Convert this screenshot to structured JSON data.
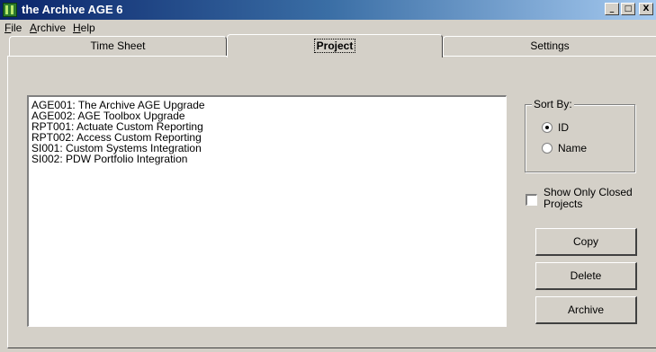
{
  "window": {
    "title": "the Archive AGE 6",
    "icon": "archive-app-icon",
    "controls": {
      "minimize": "_",
      "maximize": "□",
      "close": "X"
    }
  },
  "menu": {
    "file": {
      "mnemonic": "F",
      "rest": "ile"
    },
    "archive": {
      "mnemonic": "A",
      "rest": "rchive"
    },
    "help": {
      "mnemonic": "H",
      "rest": "elp"
    }
  },
  "tabs": [
    {
      "label": "Time Sheet",
      "active": false
    },
    {
      "label": "Project",
      "active": true
    },
    {
      "label": "Settings",
      "active": false
    }
  ],
  "projects": [
    "AGE001:  The Archive AGE Upgrade",
    "AGE002:  AGE Toolbox Upgrade",
    "RPT001:  Actuate Custom Reporting",
    "RPT002:  Access Custom Reporting",
    "SI001:  Custom Systems Integration",
    "SI002:  PDW Portfolio Integration"
  ],
  "sort": {
    "label": "Sort By:",
    "options": [
      {
        "label": "ID",
        "checked": true
      },
      {
        "label": "Name",
        "checked": false
      }
    ]
  },
  "filter": {
    "label": "Show Only Closed Projects",
    "checked": false
  },
  "buttons": {
    "copy": "Copy",
    "delete": "Delete",
    "archive": "Archive"
  }
}
